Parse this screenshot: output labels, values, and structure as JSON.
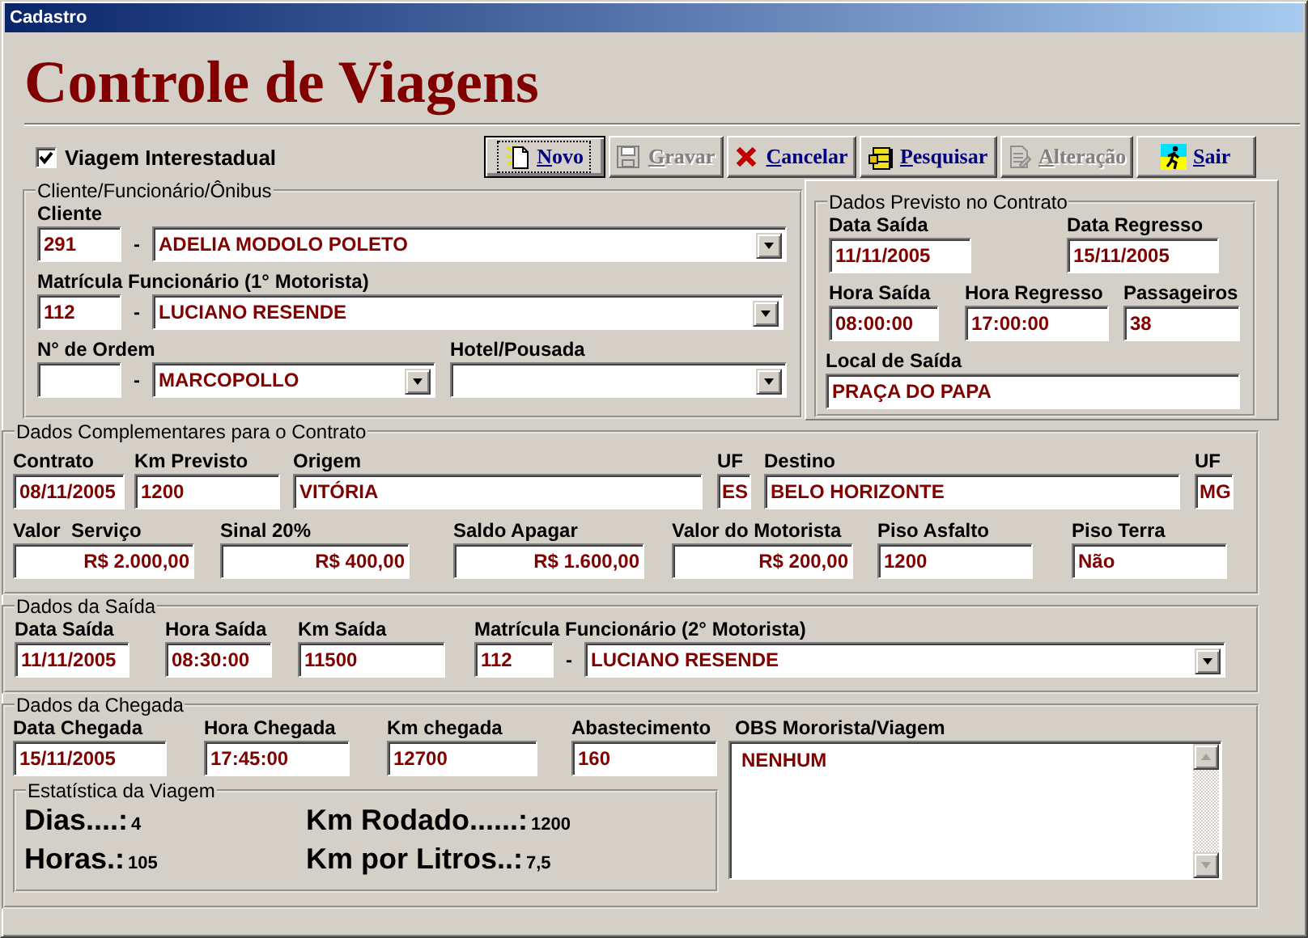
{
  "window": {
    "title": "Cadastro"
  },
  "heading": "Controle de Viagens",
  "interstate": {
    "label": "Viagem Interestadual",
    "checked": true
  },
  "toolbar": [
    {
      "label": "Novo",
      "kind": "new",
      "disabled": false,
      "focused": true
    },
    {
      "label": "Gravar",
      "kind": "save",
      "disabled": true,
      "focused": false
    },
    {
      "label": "Cancelar",
      "kind": "cancel",
      "disabled": false,
      "focused": false
    },
    {
      "label": "Pesquisar",
      "kind": "search",
      "disabled": false,
      "focused": false
    },
    {
      "label": "Alteração",
      "kind": "edit",
      "disabled": true,
      "focused": false
    },
    {
      "label": "Sair",
      "kind": "exit",
      "disabled": false,
      "focused": false
    }
  ],
  "groups": [
    {
      "legend": "Cliente/Funcionário/Ônibus",
      "fields": [
        {
          "kind": "code_combo",
          "label": "Cliente",
          "code": "291",
          "separator": "-",
          "selection": "ADELIA MODOLO POLETO"
        },
        {
          "kind": "code_combo",
          "label": "Matrícula Funcionário (1° Motorista)",
          "code": "112",
          "separator": "-",
          "selection": "LUCIANO RESENDE"
        },
        {
          "kind": "code_combo",
          "label": "N° de Ordem",
          "separator": "-",
          "selection": "MARCOPOLLO"
        },
        {
          "kind": "combo",
          "label": "Hotel/Pousada"
        }
      ]
    },
    {
      "legend": "Dados Previsto no Contrato",
      "fields": [
        {
          "kind": "text",
          "label": "Data Saída",
          "value": "11/11/2005"
        },
        {
          "kind": "text",
          "label": "Data Regresso",
          "value": "15/11/2005"
        },
        {
          "kind": "text",
          "label": "Hora Saída",
          "value": "08:00:00"
        },
        {
          "kind": "text",
          "label": "Hora Regresso",
          "value": "17:00:00"
        },
        {
          "kind": "text",
          "label": "Passageiros",
          "value": "38"
        },
        {
          "kind": "text",
          "label": "Local de Saída",
          "value": "PRAÇA DO PAPA"
        }
      ]
    },
    {
      "legend": "Dados Complementares para o Contrato",
      "fields": [
        {
          "kind": "text",
          "label": "Contrato",
          "value": "08/11/2005"
        },
        {
          "kind": "text",
          "label": "Km Previsto",
          "value": "1200"
        },
        {
          "kind": "text",
          "label": "Origem",
          "value": "VITÓRIA"
        },
        {
          "kind": "text",
          "label": "UF",
          "value": "ES"
        },
        {
          "kind": "text",
          "label": "Destino",
          "value": "BELO HORIZONTE"
        },
        {
          "kind": "text",
          "label": "UF",
          "value": "MG"
        },
        {
          "kind": "money",
          "label": "Valor  Serviço",
          "value": "R$ 2.000,00"
        },
        {
          "kind": "money",
          "label": "Sinal 20%",
          "value": "R$ 400,00"
        },
        {
          "kind": "money",
          "label": "Saldo Apagar",
          "value": "R$ 1.600,00"
        },
        {
          "kind": "money",
          "label": "Valor do Motorista",
          "value": "R$ 200,00"
        },
        {
          "kind": "text",
          "label": "Piso Asfalto",
          "value": "1200"
        },
        {
          "kind": "text",
          "label": "Piso Terra",
          "value": "Não"
        }
      ]
    },
    {
      "legend": "Dados da Saída",
      "fields": [
        {
          "kind": "text",
          "label": "Data Saída",
          "value": "11/11/2005"
        },
        {
          "kind": "text",
          "label": "Hora Saída",
          "value": "08:30:00"
        },
        {
          "kind": "text",
          "label": "Km Saída",
          "value": "11500"
        },
        {
          "kind": "code_combo",
          "label": "Matrícula Funcionário (2° Motorista)",
          "code": "112",
          "separator": "-",
          "selection": "LUCIANO RESENDE"
        }
      ]
    },
    {
      "legend": "Dados da Chegada",
      "fields": [
        {
          "kind": "text",
          "label": "Data Chegada",
          "value": "15/11/2005"
        },
        {
          "kind": "text",
          "label": "Hora Chegada",
          "value": "17:45:00"
        },
        {
          "kind": "text",
          "label": "Km chegada",
          "value": "12700"
        },
        {
          "kind": "text",
          "label": "Abastecimento",
          "value": "160"
        }
      ],
      "statistics": {
        "legend": "Estatística da Viagem",
        "items": [
          {
            "label": "Dias....:",
            "value": "4"
          },
          {
            "label": "Km Rodado......:",
            "value": "1200"
          },
          {
            "label": "Horas.:",
            "value": "105"
          },
          {
            "label": "Km por Litros..:",
            "value": "7,5"
          }
        ]
      },
      "notes": {
        "label": "OBS Mororista/Viagem",
        "value": "NENHUM"
      }
    }
  ]
}
